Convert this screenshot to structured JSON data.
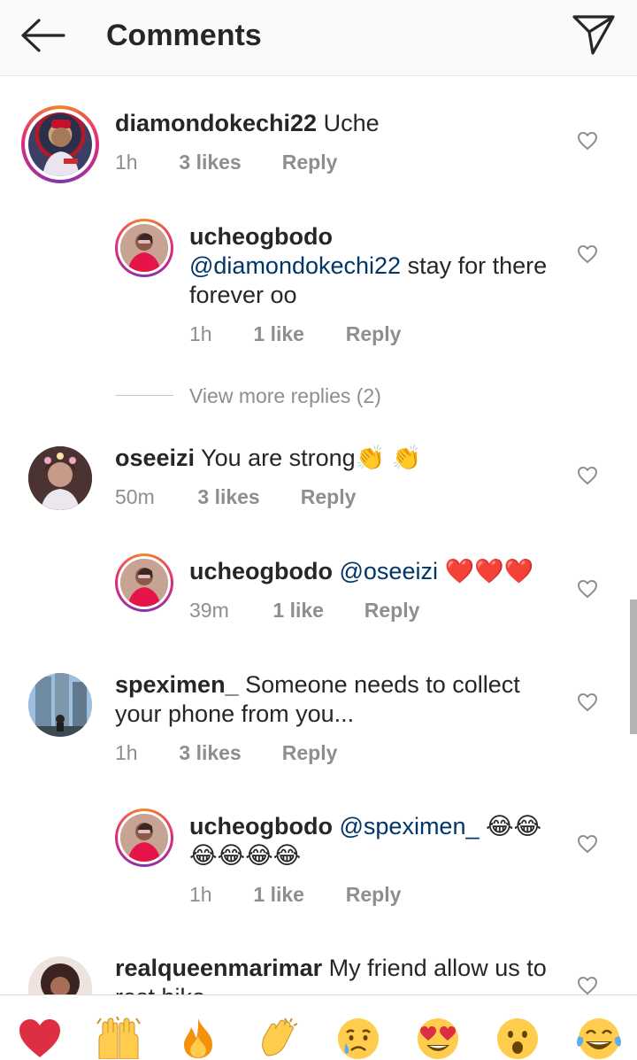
{
  "header": {
    "title": "Comments",
    "back_icon": "arrow-left-icon",
    "share_icon": "paper-plane-icon"
  },
  "comments": [
    {
      "username": "diamondokechi22",
      "text": " Uche",
      "time": "1h",
      "likes": "3 likes",
      "reply": "Reply",
      "avatar_ring": true,
      "is_reply": false
    },
    {
      "username": "ucheogbodo",
      "mention": "@diamondokechi22",
      "text": " stay for there forever oo",
      "time": "1h",
      "likes": "1 like",
      "reply": "Reply",
      "avatar_ring": true,
      "is_reply": true
    },
    {
      "username": "oseeizi",
      "text": " You are strong👏 👏",
      "time": "50m",
      "likes": "3 likes",
      "reply": "Reply",
      "avatar_ring": false,
      "is_reply": false
    },
    {
      "username": "ucheogbodo",
      "mention": "@oseeizi",
      "text": " ❤️❤️❤️",
      "time": "39m",
      "likes": "1 like",
      "reply": "Reply",
      "avatar_ring": true,
      "is_reply": true
    },
    {
      "username": "speximen_",
      "text": " Someone needs to collect your phone from you...",
      "time": "1h",
      "likes": "3 likes",
      "reply": "Reply",
      "avatar_ring": false,
      "is_reply": false
    },
    {
      "username": "ucheogbodo",
      "mention": "@speximen_",
      "text": " 😂😂 😂😂😂😂",
      "time": "1h",
      "likes": "1 like",
      "reply": "Reply",
      "avatar_ring": true,
      "is_reply": true
    },
    {
      "username": "realqueenmarimar",
      "text": " My friend allow us to rest biko",
      "avatar_ring": false,
      "is_reply": false
    }
  ],
  "view_more_replies": "View more replies (2)",
  "heart_icon": "heart-outline-icon",
  "emoji_bar": [
    {
      "emoji": "❤️",
      "name": "red-heart"
    },
    {
      "emoji": "🙌",
      "name": "raising-hands"
    },
    {
      "emoji": "🔥",
      "name": "fire"
    },
    {
      "emoji": "👏",
      "name": "clapping-hands"
    },
    {
      "emoji": "😢",
      "name": "crying-face"
    },
    {
      "emoji": "😍",
      "name": "heart-eyes"
    },
    {
      "emoji": "😮",
      "name": "open-mouth"
    },
    {
      "emoji": "😂",
      "name": "tears-of-joy"
    }
  ],
  "colors": {
    "mention": "#003569",
    "meta_gray": "#8e8e8e",
    "text": "#262626"
  }
}
